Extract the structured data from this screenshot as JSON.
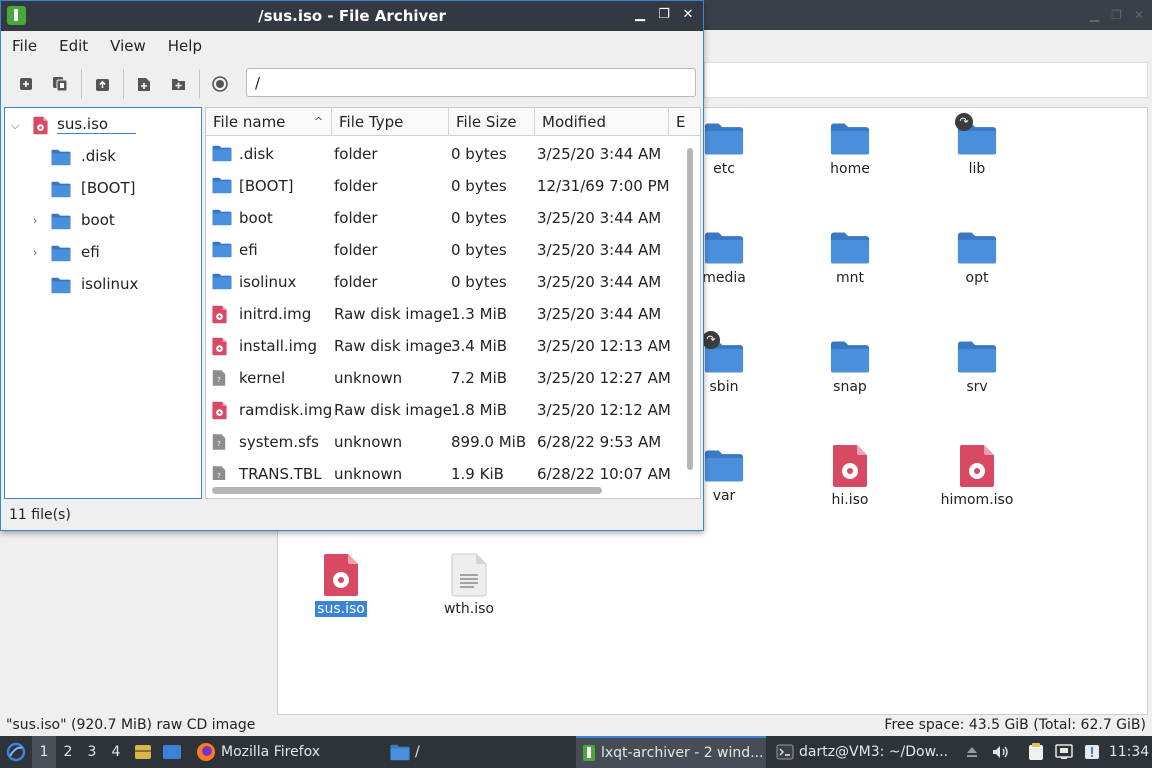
{
  "file_manager": {
    "items": [
      {
        "name": "etc",
        "icon": "folder-icon",
        "link": false
      },
      {
        "name": "home",
        "icon": "folder-icon",
        "link": false
      },
      {
        "name": "lib",
        "icon": "folder-icon",
        "link": true
      },
      {
        "name": "media",
        "icon": "folder-icon",
        "link": false
      },
      {
        "name": "mnt",
        "icon": "folder-icon",
        "link": false
      },
      {
        "name": "opt",
        "icon": "folder-icon",
        "link": false
      },
      {
        "name": "sbin",
        "icon": "folder-icon",
        "link": true
      },
      {
        "name": "snap",
        "icon": "folder-icon",
        "link": false
      },
      {
        "name": "srv",
        "icon": "folder-icon",
        "link": false
      },
      {
        "name": "var",
        "icon": "folder-icon",
        "link": false
      },
      {
        "name": "hi.iso",
        "icon": "disk-image-icon",
        "link": false
      },
      {
        "name": "himom.iso",
        "icon": "disk-image-icon",
        "link": false
      },
      {
        "name": "sus.iso",
        "icon": "disk-image-icon",
        "link": false,
        "selected": true
      },
      {
        "name": "wth.iso",
        "icon": "text-file-icon",
        "link": false
      }
    ],
    "status_left": "\"sus.iso\" (920.7 MiB) raw CD image",
    "status_right": "Free space: 43.5 GiB (Total: 62.7 GiB)"
  },
  "archiver": {
    "title": "/sus.iso - File Archiver",
    "menu": [
      "File",
      "Edit",
      "View",
      "Help"
    ],
    "path": "/",
    "tree": {
      "root": "sus.iso",
      "children": [
        {
          "name": ".disk",
          "expandable": false
        },
        {
          "name": "[BOOT]",
          "expandable": false
        },
        {
          "name": "boot",
          "expandable": true
        },
        {
          "name": "efi",
          "expandable": true
        },
        {
          "name": "isolinux",
          "expandable": false
        }
      ]
    },
    "columns": [
      "File name",
      "File Type",
      "File Size",
      "Modified",
      "E"
    ],
    "files": [
      {
        "name": ".disk",
        "type": "folder",
        "size": "0 bytes",
        "modified": "3/25/20 3:44 AM",
        "icon": "folder-icon"
      },
      {
        "name": "[BOOT]",
        "type": "folder",
        "size": "0 bytes",
        "modified": "12/31/69 7:00 PM",
        "icon": "folder-icon"
      },
      {
        "name": "boot",
        "type": "folder",
        "size": "0 bytes",
        "modified": "3/25/20 3:44 AM",
        "icon": "folder-icon"
      },
      {
        "name": "efi",
        "type": "folder",
        "size": "0 bytes",
        "modified": "3/25/20 3:44 AM",
        "icon": "folder-icon"
      },
      {
        "name": "isolinux",
        "type": "folder",
        "size": "0 bytes",
        "modified": "3/25/20 3:44 AM",
        "icon": "folder-icon"
      },
      {
        "name": "initrd.img",
        "type": "Raw disk image",
        "size": "1.3 MiB",
        "modified": "3/25/20 3:44 AM",
        "icon": "disk-image-icon"
      },
      {
        "name": "install.img",
        "type": "Raw disk image",
        "size": "3.4 MiB",
        "modified": "3/25/20 12:13 AM",
        "icon": "disk-image-icon"
      },
      {
        "name": "kernel",
        "type": "unknown",
        "size": "7.2 MiB",
        "modified": "3/25/20 12:27 AM",
        "icon": "unknown-file-icon"
      },
      {
        "name": "ramdisk.img",
        "type": "Raw disk image",
        "size": "1.8 MiB",
        "modified": "3/25/20 12:12 AM",
        "icon": "disk-image-icon"
      },
      {
        "name": "system.sfs",
        "type": "unknown",
        "size": "899.0 MiB",
        "modified": "6/28/22 9:53 AM",
        "icon": "unknown-file-icon"
      },
      {
        "name": "TRANS.TBL",
        "type": "unknown",
        "size": "1.9 KiB",
        "modified": "6/28/22 10:07 AM",
        "icon": "unknown-file-icon"
      }
    ],
    "status": "11 file(s)"
  },
  "taskbar": {
    "desktops": [
      "1",
      "2",
      "3",
      "4"
    ],
    "tasks": [
      {
        "label": "Mozilla Firefox",
        "icon": "firefox-icon"
      },
      {
        "label": "/",
        "icon": "folder-icon"
      },
      {
        "label": "lxqt-archiver - 2 wind...",
        "icon": "archiver-icon",
        "active": true
      },
      {
        "label": "dartz@VM3: ~/Dow...",
        "icon": "terminal-icon"
      }
    ],
    "clock": "11:34"
  },
  "colors": {
    "accent": "#3a83d6",
    "folder": "#4a8fdc",
    "disk_image": "#d84a63",
    "title_bar": "#343841",
    "taskbar": "#2e3239"
  }
}
